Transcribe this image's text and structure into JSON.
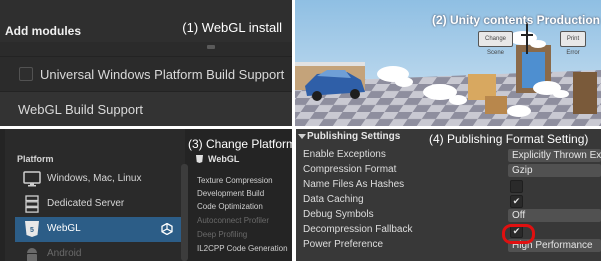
{
  "modules": {
    "header_title": "Add modules",
    "caption": "(1) WebGL install",
    "rows": [
      {
        "label": "Universal Windows Platform Build Support",
        "checked": false
      },
      {
        "label": "WebGL Build Support"
      }
    ]
  },
  "preview": {
    "caption": "(2) Unity contents Production",
    "buttons": [
      "Change Scene",
      "Print Error"
    ]
  },
  "build": {
    "caption": "(3) Change Platform",
    "platform_title": "Platform",
    "platforms": [
      {
        "label": "Windows, Mac, Linux",
        "icon": "monitor-icon"
      },
      {
        "label": "Dedicated Server",
        "icon": "server-icon"
      },
      {
        "label": "WebGL",
        "icon": "html5-icon",
        "selected": true,
        "active_icon": "unity-logo-icon"
      },
      {
        "label": "Android",
        "icon": "android-icon"
      }
    ],
    "selected_title": "WebGL",
    "settings": [
      "Texture Compression",
      "Development Build",
      "Code Optimization",
      "Autoconnect Profiler",
      "Deep Profiling",
      "IL2CPP Code Generation"
    ],
    "disabled_settings": [
      "Autoconnect Profiler",
      "Deep Profiling"
    ]
  },
  "publishing": {
    "header": "Publishing Settings",
    "caption": "(4) Publishing Format Setting)",
    "rows": [
      {
        "label": "Enable Exceptions",
        "value": "Explicitly Thrown Exceptions Only"
      },
      {
        "label": "Compression Format",
        "value": "Gzip"
      },
      {
        "label": "Name Files As Hashes",
        "checked": false
      },
      {
        "label": "Data Caching",
        "checked": true
      },
      {
        "label": "Debug Symbols",
        "value": "Off"
      },
      {
        "label": "Decompression Fallback",
        "checked": true,
        "highlighted": true
      },
      {
        "label": "Power Preference",
        "value": "High Performance"
      }
    ],
    "check_glyph": "✔",
    "highlight_color": "#e01010"
  }
}
